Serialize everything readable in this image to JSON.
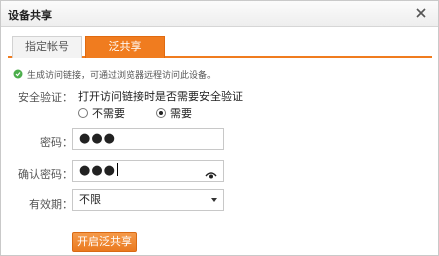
{
  "dialog": {
    "title": "设备共享"
  },
  "tabs": [
    {
      "label": "指定帐号",
      "active": false
    },
    {
      "label": "泛共享",
      "active": true
    }
  ],
  "hint": "生成访问链接，可通过浏览器远程访问此设备。",
  "security": {
    "label": "安全验证：",
    "question": "打开访问链接时是否需要安全验证",
    "options": [
      "不需要",
      "需要"
    ],
    "selected": "需要"
  },
  "password": {
    "label": "密码：",
    "value": "●●●"
  },
  "confirm_password": {
    "label": "确认密码：",
    "value": "●●●"
  },
  "validity": {
    "label": "有效期：",
    "value": "不限"
  },
  "actions": {
    "enable_label": "开启泛共享"
  },
  "colors": {
    "accent": "#f07c1f",
    "hint_icon": "#4cae4c"
  },
  "icons": {
    "close": "close-icon",
    "hint": "info-icon",
    "eye": "eye-icon",
    "dropdown": "chevron-down-icon"
  }
}
